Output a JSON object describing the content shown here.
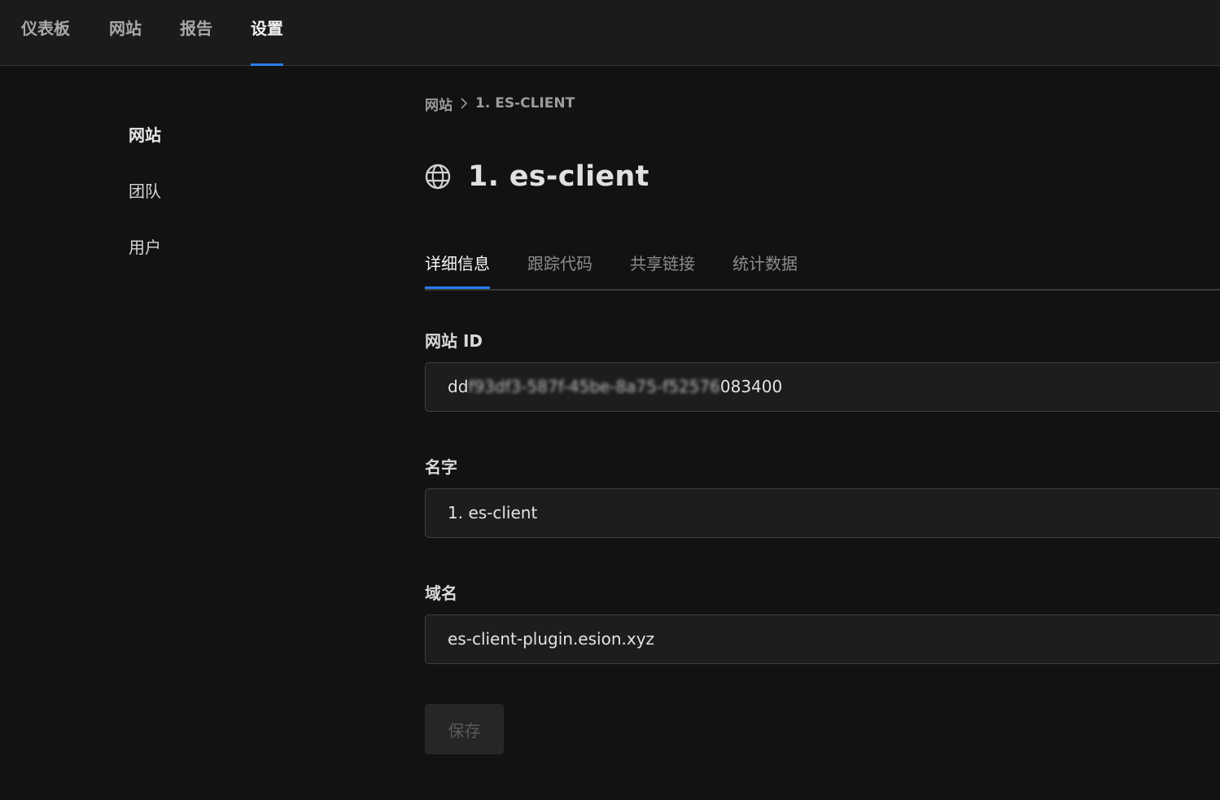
{
  "topnav": {
    "items": [
      {
        "label": "仪表板"
      },
      {
        "label": "网站"
      },
      {
        "label": "报告"
      },
      {
        "label": "设置"
      }
    ],
    "active": "设置"
  },
  "sidebar": {
    "items": [
      {
        "label": "网站"
      },
      {
        "label": "团队"
      },
      {
        "label": "用户"
      }
    ],
    "active": "网站"
  },
  "breadcrumb": {
    "parent": "网站",
    "current": "1. ES-CLIENT"
  },
  "header": {
    "icon": "globe-icon",
    "title": "1. es-client"
  },
  "tabs": [
    {
      "label": "详细信息"
    },
    {
      "label": "跟踪代码"
    },
    {
      "label": "共享链接"
    },
    {
      "label": "统计数据"
    }
  ],
  "active_tab": "详细信息",
  "form": {
    "website_id": {
      "label": "网站 ID",
      "value_prefix": "dd",
      "value_redacted": "f93df3-587f-45be-8a75-f52576",
      "value_suffix": "083400"
    },
    "name": {
      "label": "名字",
      "value": "1. es-client"
    },
    "domain": {
      "label": "域名",
      "value": "es-client-plugin.esion.xyz"
    },
    "save_label": "保存"
  },
  "colors": {
    "accent": "#2b7cf0",
    "background": "#121212",
    "topbar": "#1b1b1b",
    "input_bg": "#1d1d1d"
  }
}
